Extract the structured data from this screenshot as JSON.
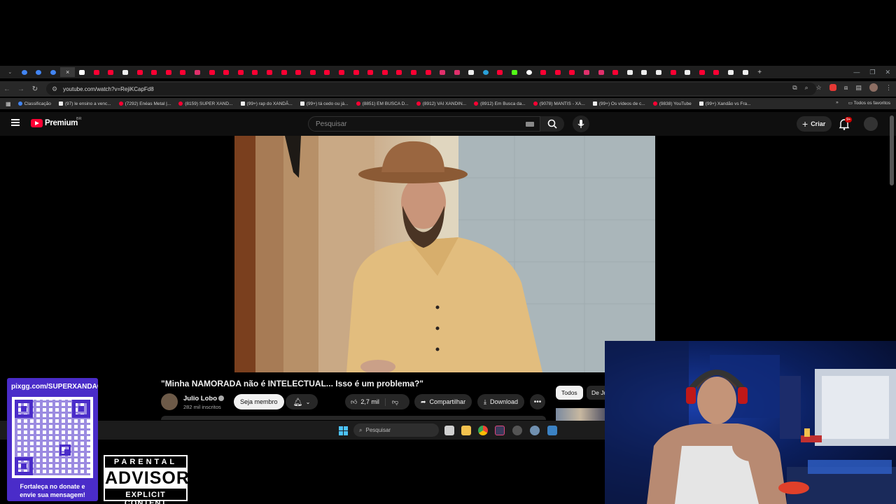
{
  "browser": {
    "url": "youtube.com/watch?v=RejiKCapFd8",
    "tab_active_label": "×",
    "new_tab_label": "+",
    "bookmarks": [
      {
        "label": "Classificação",
        "kind": "cl"
      },
      {
        "label": "(97) le ensino a venc...",
        "kind": "tk"
      },
      {
        "label": "(7292) Enéas Metal |...",
        "kind": "yt"
      },
      {
        "label": "(8159) SUPER XAND...",
        "kind": "yt"
      },
      {
        "label": "(99+) rap do XANDÃ...",
        "kind": "tk"
      },
      {
        "label": "(99+) tá cedo ou já...",
        "kind": "tk"
      },
      {
        "label": "(8851) EM BUSCA D...",
        "kind": "yt"
      },
      {
        "label": "(8912) VAI XANDIN...",
        "kind": "yt"
      },
      {
        "label": "(8912) Em Busca da...",
        "kind": "yt"
      },
      {
        "label": "(9078) MANTIS - XA...",
        "kind": "yt"
      },
      {
        "label": "(99+) Os vídeos de c...",
        "kind": "tk"
      },
      {
        "label": "(9838) YouTube",
        "kind": "yt"
      },
      {
        "label": "(99+) Xandão vs Fra...",
        "kind": "tk"
      }
    ],
    "bookmarks_more": "»",
    "all_bookmarks": "Todos os favoritos"
  },
  "youtube": {
    "brand": "Premium",
    "region": "BR",
    "search_placeholder": "Pesquisar",
    "create_label": "Criar",
    "notif_badge": "9+",
    "video_title": "\"Minha NAMORADA não é INTELECTUAL... Isso é um problema?\"",
    "channel_name": "Julio Lobo",
    "subscribers": "282 mil inscritos",
    "member_button": "Seja membro",
    "likes": "2,7 mil",
    "share_label": "Compartilhar",
    "download_label": "Download",
    "chips": [
      "Todos",
      "De Ju"
    ]
  },
  "taskbar": {
    "search_label": "Pesquisar"
  },
  "overlay": {
    "pix_url": "pixgg.com/SUPERXANDAO",
    "pix_message_line1": "Fortaleça no donate e",
    "pix_message_line2": "envie sua mensagem!",
    "advisory_top": "PARENTAL",
    "advisory_main": "ADVISORY",
    "advisory_bottom": "EXPLICIT CONTENT"
  },
  "colors": {
    "yt_red": "#ff0033",
    "pix_purple": "#4a2cc9",
    "page_bg": "#0f0f0f"
  }
}
